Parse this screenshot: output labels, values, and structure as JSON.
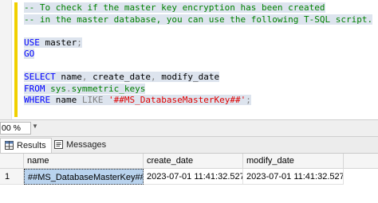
{
  "editor": {
    "lines": [
      [
        {
          "c": "cm",
          "t": "-- To check if the master key encryption has been created"
        }
      ],
      [
        {
          "c": "cm",
          "t": "-- in the master database, you can use the following T-SQL script."
        }
      ],
      [
        {
          "c": "tx",
          "t": ""
        }
      ],
      [
        {
          "c": "kw",
          "t": "USE"
        },
        {
          "c": "tx",
          "t": " master"
        },
        {
          "c": "gr",
          "t": ";"
        }
      ],
      [
        {
          "c": "kw",
          "t": "GO"
        }
      ],
      [
        {
          "c": "tx",
          "t": ""
        }
      ],
      [
        {
          "c": "kw",
          "t": "SELECT"
        },
        {
          "c": "tx",
          "t": " name"
        },
        {
          "c": "gr",
          "t": ","
        },
        {
          "c": "tx",
          "t": " create_date"
        },
        {
          "c": "gr",
          "t": ","
        },
        {
          "c": "tx",
          "t": " modify_date"
        }
      ],
      [
        {
          "c": "kw",
          "t": "FROM"
        },
        {
          "c": "tx",
          "t": " "
        },
        {
          "c": "fn",
          "t": "sys"
        },
        {
          "c": "gr",
          "t": "."
        },
        {
          "c": "fn",
          "t": "symmetric_keys"
        }
      ],
      [
        {
          "c": "kw",
          "t": "WHERE"
        },
        {
          "c": "tx",
          "t": " name "
        },
        {
          "c": "gr",
          "t": "LIKE"
        },
        {
          "c": "tx",
          "t": " "
        },
        {
          "c": "st",
          "t": "'##MS_DatabaseMasterKey##'"
        },
        {
          "c": "gr",
          "t": ";"
        }
      ]
    ]
  },
  "zoom": {
    "value": "00 %"
  },
  "tabs": {
    "results": "Results",
    "messages": "Messages"
  },
  "grid": {
    "columns": [
      "name",
      "create_date",
      "modify_date"
    ],
    "rows": [
      {
        "num": "1",
        "name": "##MS_DatabaseMasterKey##",
        "create_date": "2023-07-01 11:41:32.527",
        "modify_date": "2023-07-01 11:41:32.527"
      }
    ]
  },
  "colors": {
    "selection": "#dde4ee",
    "keyword": "#0000ff",
    "comment": "#008000",
    "string": "#e00000",
    "selected_cell": "#b9d3ee"
  }
}
